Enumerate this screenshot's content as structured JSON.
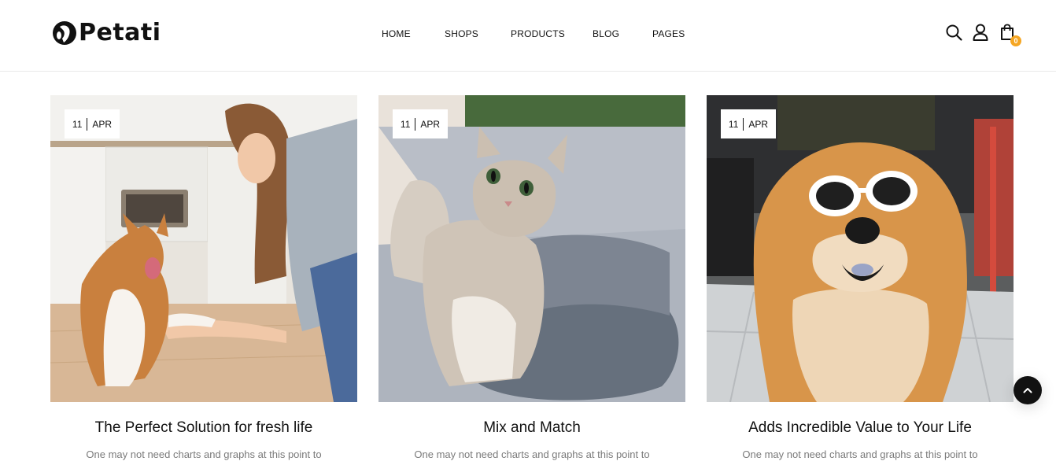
{
  "brand": {
    "name": "Petati"
  },
  "nav": {
    "items": [
      "HOME",
      "SHOPS",
      "PRODUCTS",
      "BLOG",
      "PAGES"
    ]
  },
  "header_icons": {
    "search": "search-icon",
    "account": "user-icon",
    "cart": "shopping-bag-icon",
    "cart_count": "0",
    "badge_color": "#f5a623"
  },
  "posts": [
    {
      "day": "11",
      "month": "APR",
      "title": "The Perfect Solution for fresh life",
      "excerpt": "One may not need charts and graphs at this point to",
      "image": "woman-with-corgi-photo"
    },
    {
      "day": "11",
      "month": "APR",
      "title": "Mix and Match",
      "excerpt": "One may not need charts and graphs at this point to",
      "image": "kitten-on-pillow-photo"
    },
    {
      "day": "11",
      "month": "APR",
      "title": "Adds Incredible Value to Your Life",
      "excerpt": "One may not need charts and graphs at this point to",
      "image": "dog-with-sunglasses-photo"
    }
  ],
  "scroll_top": {
    "icon": "chevron-up-icon"
  }
}
